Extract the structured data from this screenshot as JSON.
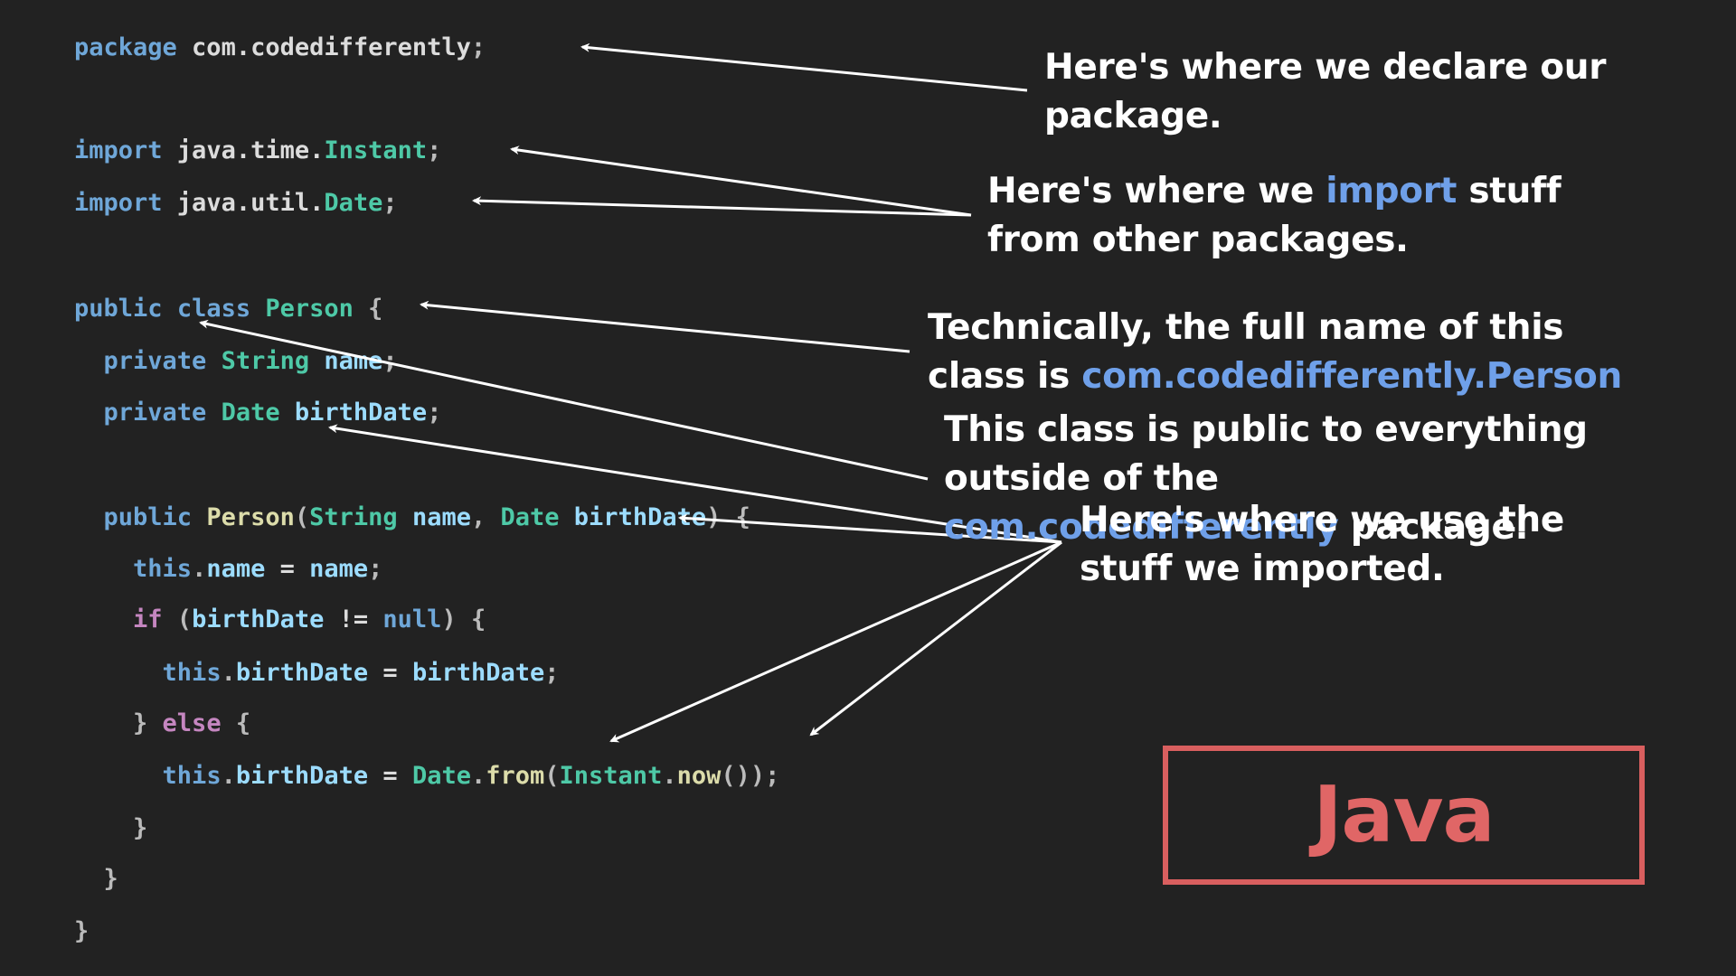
{
  "colors": {
    "background": "#222222",
    "keyword": "#6fa7d8",
    "type": "#4ec9a7",
    "identifier": "#9cdcfe",
    "plain": "#dcdcdc",
    "method": "#dcdcaa",
    "control": "#c586c0",
    "punct": "#bbbbbb",
    "callout_text": "#ffffff",
    "callout_highlight": "#6fa0e9",
    "badge_border": "#d95f5f",
    "badge_text": "#e06666"
  },
  "code_lines": [
    [
      {
        "t": "package",
        "k": "keyword"
      },
      {
        "t": " com.codedifferently",
        "k": "plain"
      },
      {
        "t": ";",
        "k": "punct"
      }
    ],
    [],
    [
      {
        "t": "import",
        "k": "keyword"
      },
      {
        "t": " java.time.",
        "k": "plain"
      },
      {
        "t": "Instant",
        "k": "type"
      },
      {
        "t": ";",
        "k": "punct"
      }
    ],
    [
      {
        "t": "import",
        "k": "keyword"
      },
      {
        "t": " java.util.",
        "k": "plain"
      },
      {
        "t": "Date",
        "k": "type"
      },
      {
        "t": ";",
        "k": "punct"
      }
    ],
    [],
    [
      {
        "t": "public",
        "k": "keyword"
      },
      {
        "t": " ",
        "k": "plain"
      },
      {
        "t": "class",
        "k": "keyword"
      },
      {
        "t": " ",
        "k": "plain"
      },
      {
        "t": "Person",
        "k": "type"
      },
      {
        "t": " {",
        "k": "punct"
      }
    ],
    [
      {
        "t": "  ",
        "k": "plain"
      },
      {
        "t": "private",
        "k": "keyword"
      },
      {
        "t": " ",
        "k": "plain"
      },
      {
        "t": "String",
        "k": "type"
      },
      {
        "t": " ",
        "k": "plain"
      },
      {
        "t": "name",
        "k": "identifier"
      },
      {
        "t": ";",
        "k": "punct"
      }
    ],
    [
      {
        "t": "  ",
        "k": "plain"
      },
      {
        "t": "private",
        "k": "keyword"
      },
      {
        "t": " ",
        "k": "plain"
      },
      {
        "t": "Date",
        "k": "type"
      },
      {
        "t": " ",
        "k": "plain"
      },
      {
        "t": "birthDate",
        "k": "identifier"
      },
      {
        "t": ";",
        "k": "punct"
      }
    ],
    [],
    [
      {
        "t": "  ",
        "k": "plain"
      },
      {
        "t": "public",
        "k": "keyword"
      },
      {
        "t": " ",
        "k": "plain"
      },
      {
        "t": "Person",
        "k": "method"
      },
      {
        "t": "(",
        "k": "punct"
      },
      {
        "t": "String",
        "k": "type"
      },
      {
        "t": " ",
        "k": "plain"
      },
      {
        "t": "name",
        "k": "identifier"
      },
      {
        "t": ", ",
        "k": "punct"
      },
      {
        "t": "Date",
        "k": "type"
      },
      {
        "t": " ",
        "k": "plain"
      },
      {
        "t": "birthDate",
        "k": "identifier"
      },
      {
        "t": ") {",
        "k": "punct"
      }
    ],
    [
      {
        "t": "    ",
        "k": "plain"
      },
      {
        "t": "this",
        "k": "keyword"
      },
      {
        "t": ".",
        "k": "punct"
      },
      {
        "t": "name",
        "k": "identifier"
      },
      {
        "t": " = ",
        "k": "plain"
      },
      {
        "t": "name",
        "k": "identifier"
      },
      {
        "t": ";",
        "k": "punct"
      }
    ],
    [
      {
        "t": "    ",
        "k": "plain"
      },
      {
        "t": "if",
        "k": "control"
      },
      {
        "t": " (",
        "k": "punct"
      },
      {
        "t": "birthDate",
        "k": "identifier"
      },
      {
        "t": " != ",
        "k": "plain"
      },
      {
        "t": "null",
        "k": "keyword"
      },
      {
        "t": ") {",
        "k": "punct"
      }
    ],
    [
      {
        "t": "      ",
        "k": "plain"
      },
      {
        "t": "this",
        "k": "keyword"
      },
      {
        "t": ".",
        "k": "punct"
      },
      {
        "t": "birthDate",
        "k": "identifier"
      },
      {
        "t": " = ",
        "k": "plain"
      },
      {
        "t": "birthDate",
        "k": "identifier"
      },
      {
        "t": ";",
        "k": "punct"
      }
    ],
    [
      {
        "t": "    ",
        "k": "plain"
      },
      {
        "t": "} ",
        "k": "punct"
      },
      {
        "t": "else",
        "k": "control"
      },
      {
        "t": " {",
        "k": "punct"
      }
    ],
    [
      {
        "t": "      ",
        "k": "plain"
      },
      {
        "t": "this",
        "k": "keyword"
      },
      {
        "t": ".",
        "k": "punct"
      },
      {
        "t": "birthDate",
        "k": "identifier"
      },
      {
        "t": " = ",
        "k": "plain"
      },
      {
        "t": "Date",
        "k": "type"
      },
      {
        "t": ".",
        "k": "punct"
      },
      {
        "t": "from",
        "k": "method"
      },
      {
        "t": "(",
        "k": "punct"
      },
      {
        "t": "Instant",
        "k": "type"
      },
      {
        "t": ".",
        "k": "punct"
      },
      {
        "t": "now",
        "k": "method"
      },
      {
        "t": "());",
        "k": "punct"
      }
    ],
    [
      {
        "t": "    }",
        "k": "punct"
      }
    ],
    [
      {
        "t": "  }",
        "k": "punct"
      }
    ],
    [
      {
        "t": "}",
        "k": "punct"
      }
    ]
  ],
  "callouts": {
    "package": [
      {
        "t": "Here's where we declare our package."
      }
    ],
    "import": [
      {
        "t": "Here's where we "
      },
      {
        "t": "import",
        "hl": true
      },
      {
        "t": " stuff from other packages."
      }
    ],
    "fullname": [
      {
        "t": "Technically, the full name of this class is "
      },
      {
        "t": "com.codedifferently.Person",
        "hl": true
      }
    ],
    "public": [
      {
        "t": "This class is public to everything outside of the "
      },
      {
        "t": "com.codedifferently",
        "hl": true
      },
      {
        "t": " package."
      }
    ],
    "use": [
      {
        "t": "Here's where we use the stuff we imported."
      }
    ]
  },
  "badge": {
    "label": "Java"
  }
}
